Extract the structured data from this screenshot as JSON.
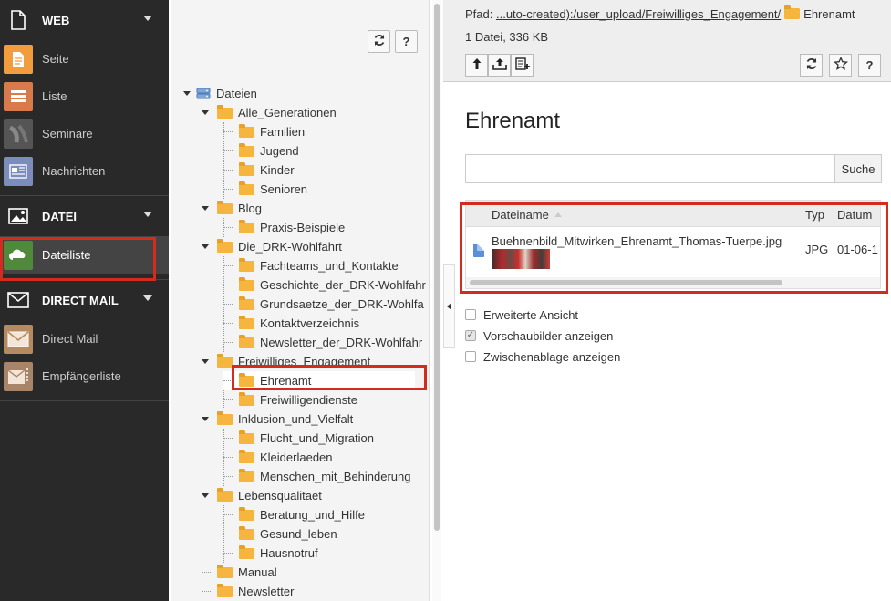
{
  "module_menu": {
    "groups": [
      {
        "title": "WEB",
        "icon": "page-icon",
        "items": [
          {
            "label": "Seite",
            "icon": "page-module-icon",
            "color": "#f29c3b"
          },
          {
            "label": "Liste",
            "icon": "list-module-icon",
            "color": "#d87a49"
          },
          {
            "label": "Seminare",
            "icon": "seminar-module-icon",
            "color": "#555555"
          },
          {
            "label": "Nachrichten",
            "icon": "news-module-icon",
            "color": "#7d8dbb"
          }
        ]
      },
      {
        "title": "DATEI",
        "icon": "image-icon",
        "items": [
          {
            "label": "Dateiliste",
            "icon": "filelist-module-icon",
            "color": "#4f8a3a",
            "active": true
          }
        ]
      },
      {
        "title": "DIRECT MAIL",
        "icon": "envelope-icon",
        "items": [
          {
            "label": "Direct Mail",
            "icon": "directmail-module-icon",
            "color": "#b58a5f"
          },
          {
            "label": "Empfängerliste",
            "icon": "recipient-list-icon",
            "color": "#a88468"
          }
        ]
      }
    ]
  },
  "tree_toolbar": {
    "refresh_icon": "refresh-icon",
    "help_label": "?"
  },
  "tree": {
    "root": "Dateien",
    "nodes": [
      "Alle_Generationen",
      "Familien",
      "Jugend",
      "Kinder",
      "Senioren",
      "Blog",
      "Praxis-Beispiele",
      "Die_DRK-Wohlfahrt",
      "Fachteams_und_Kontakte",
      "Geschichte_der_DRK-Wohlfahr",
      "Grundsaetze_der_DRK-Wohlfa",
      "Kontaktverzeichnis",
      "Newsletter_der_DRK-Wohlfahr",
      "Freiwilliges_Engagement",
      "Ehrenamt",
      "Freiwilligendienste",
      "Inklusion_und_Vielfalt",
      "Flucht_und_Migration",
      "Kleiderlaeden",
      "Menschen_mit_Behinderung",
      "Lebensqualitaet",
      "Beratung_und_Hilfe",
      "Gesund_leben",
      "Hausnotruf",
      "Manual",
      "Newsletter"
    ]
  },
  "header": {
    "path_label": "Pfad:",
    "path_link": "...uto-created):/user_upload/Freiwilliges_Engagement/",
    "path_current": "Ehrenamt",
    "file_info": "1 Datei, 336 KB",
    "buttons": {
      "up": "↑",
      "upload": "⇧",
      "new": "+",
      "refresh": "⟳",
      "bookmark": "☆",
      "help": "?"
    }
  },
  "content": {
    "title": "Ehrenamt",
    "search": {
      "value": "",
      "button_label": "Suche"
    },
    "table": {
      "columns": [
        "Dateiname",
        "Typ",
        "Datum"
      ],
      "rows": [
        {
          "name": "Buehnenbild_Mitwirken_Ehrenamt_Thomas-Tuerpe.jpg",
          "type": "JPG",
          "date": "01-06-1"
        }
      ]
    },
    "options": [
      {
        "label": "Erweiterte Ansicht",
        "checked": false
      },
      {
        "label": "Vorschaubilder anzeigen",
        "checked": true
      },
      {
        "label": "Zwischenablage anzeigen",
        "checked": false
      }
    ]
  },
  "colors": {
    "highlight": "#d52b1e",
    "folder": "#f6b53e",
    "menu_bg": "#292929"
  }
}
